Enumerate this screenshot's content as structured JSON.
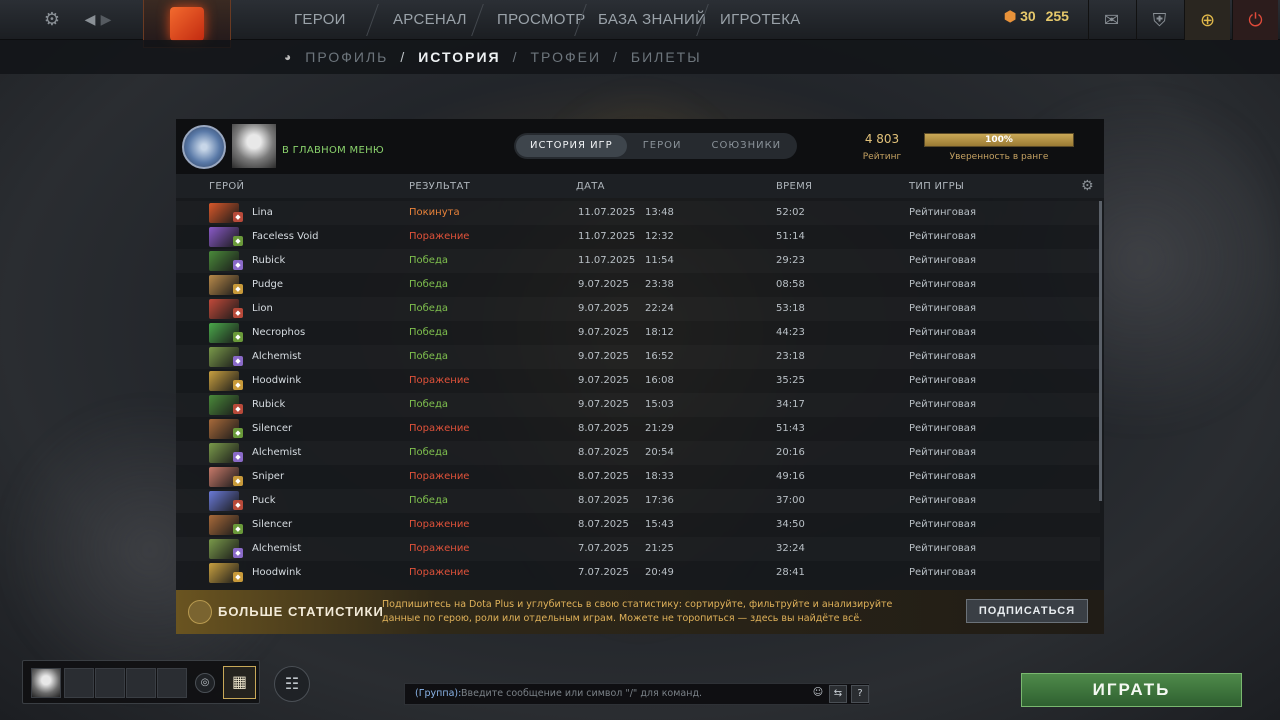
{
  "topbar": {
    "nav": [
      "ГЕРОИ",
      "АРСЕНАЛ",
      "ПРОСМОТР",
      "БАЗА ЗНАНИЙ",
      "ИГРОТЕКА"
    ],
    "currency_a": "30",
    "currency_b": "255"
  },
  "subnav": {
    "items": [
      "ПРОФИЛЬ",
      "ИСТОРИЯ",
      "ТРОФЕИ",
      "БИЛЕТЫ"
    ],
    "sep": "/"
  },
  "profile": {
    "status": "В ГЛАВНОМ МЕНЮ",
    "tabs": [
      "ИСТОРИЯ ИГР",
      "ГЕРОИ",
      "СОЮЗНИКИ"
    ],
    "rating_value": "4 803",
    "rating_label": "Рейтинг",
    "confidence_value": "100%",
    "confidence_fraction": 1.0,
    "confidence_label": "Уверенность в ранге"
  },
  "table": {
    "headers": [
      "ГЕРОЙ",
      "РЕЗУЛЬТАТ",
      "ДАТА",
      "ВРЕМЯ",
      "ТИП ИГРЫ"
    ],
    "rows": [
      {
        "hero": "Lina",
        "result": "Покинута",
        "date": "11.07.2025",
        "time": "13:48",
        "duration": "52:02",
        "type": "Рейтинговая"
      },
      {
        "hero": "Faceless Void",
        "result": "Поражение",
        "date": "11.07.2025",
        "time": "12:32",
        "duration": "51:14",
        "type": "Рейтинговая"
      },
      {
        "hero": "Rubick",
        "result": "Победа",
        "date": "11.07.2025",
        "time": "11:54",
        "duration": "29:23",
        "type": "Рейтинговая"
      },
      {
        "hero": "Pudge",
        "result": "Победа",
        "date": "9.07.2025",
        "time": "23:38",
        "duration": "08:58",
        "type": "Рейтинговая"
      },
      {
        "hero": "Lion",
        "result": "Победа",
        "date": "9.07.2025",
        "time": "22:24",
        "duration": "53:18",
        "type": "Рейтинговая"
      },
      {
        "hero": "Necrophos",
        "result": "Победа",
        "date": "9.07.2025",
        "time": "18:12",
        "duration": "44:23",
        "type": "Рейтинговая"
      },
      {
        "hero": "Alchemist",
        "result": "Победа",
        "date": "9.07.2025",
        "time": "16:52",
        "duration": "23:18",
        "type": "Рейтинговая"
      },
      {
        "hero": "Hoodwink",
        "result": "Поражение",
        "date": "9.07.2025",
        "time": "16:08",
        "duration": "35:25",
        "type": "Рейтинговая"
      },
      {
        "hero": "Rubick",
        "result": "Победа",
        "date": "9.07.2025",
        "time": "15:03",
        "duration": "34:17",
        "type": "Рейтинговая"
      },
      {
        "hero": "Silencer",
        "result": "Поражение",
        "date": "8.07.2025",
        "time": "21:29",
        "duration": "51:43",
        "type": "Рейтинговая"
      },
      {
        "hero": "Alchemist",
        "result": "Победа",
        "date": "8.07.2025",
        "time": "20:54",
        "duration": "20:16",
        "type": "Рейтинговая"
      },
      {
        "hero": "Sniper",
        "result": "Поражение",
        "date": "8.07.2025",
        "time": "18:33",
        "duration": "49:16",
        "type": "Рейтинговая"
      },
      {
        "hero": "Puck",
        "result": "Победа",
        "date": "8.07.2025",
        "time": "17:36",
        "duration": "37:00",
        "type": "Рейтинговая"
      },
      {
        "hero": "Silencer",
        "result": "Поражение",
        "date": "8.07.2025",
        "time": "15:43",
        "duration": "34:50",
        "type": "Рейтинговая"
      },
      {
        "hero": "Alchemist",
        "result": "Поражение",
        "date": "7.07.2025",
        "time": "21:25",
        "duration": "32:24",
        "type": "Рейтинговая"
      },
      {
        "hero": "Hoodwink",
        "result": "Поражение",
        "date": "7.07.2025",
        "time": "20:49",
        "duration": "28:41",
        "type": "Рейтинговая"
      }
    ]
  },
  "colors": {
    "win": "#7fc04e",
    "loss": "#e0523a",
    "abandon": "#e8823a"
  },
  "hero_colors": {
    "Lina": "#d8582a",
    "Faceless Void": "#8a5ac8",
    "Rubick": "#4a8a3a",
    "Pudge": "#b88a4a",
    "Lion": "#c24a3a",
    "Necrophos": "#4aa84a",
    "Alchemist": "#7a9a4a",
    "Hoodwink": "#c8a040",
    "Silencer": "#a86a3a",
    "Sniper": "#c87a6a",
    "Puck": "#6a7ad8"
  },
  "promo": {
    "title": "БОЛЬШЕ СТАТИСТИКИ",
    "text": "Подпишитесь на Dota Plus и углубитесь в свою статистику: сортируйте, фильтруйте и анализируйте данные по герою, роли или отдельным играм. Можете не торопиться — здесь вы найдёте всё.",
    "button": "ПОДПИСАТЬСЯ"
  },
  "chat": {
    "channel": "(Группа):",
    "placeholder": "Введите сообщение или символ \"/\" для команд.",
    "help": "?"
  },
  "play_button": "ИГРАТЬ"
}
